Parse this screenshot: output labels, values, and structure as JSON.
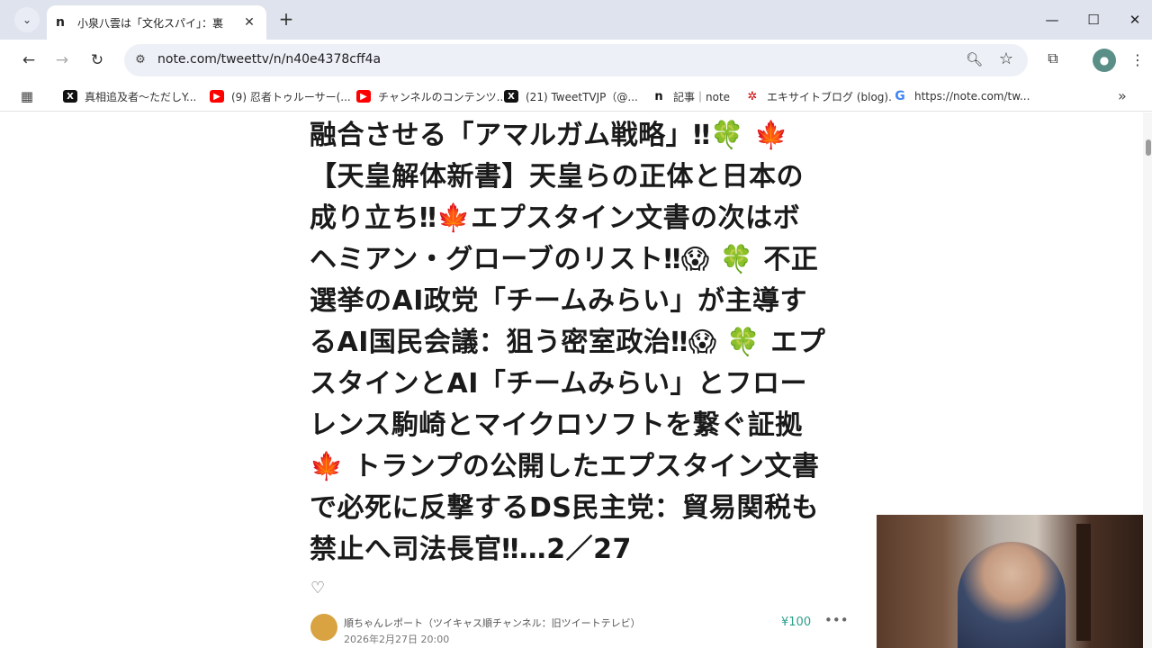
{
  "browser": {
    "tab": {
      "favicon": "n",
      "title": "小泉八雲は「文化スパイ」：裏",
      "close": "✕"
    },
    "new_tab": "+",
    "window_controls": {
      "minimize": "—",
      "maximize": "☐",
      "close": "✕"
    },
    "nav": {
      "back": "←",
      "forward": "→",
      "reload": "↻"
    },
    "url": "note.com/tweettv/n/n40e4378cff4a",
    "menu": "⋮"
  },
  "bookmarks": [
    {
      "icon": "x",
      "label": "真相追及者〜ただしY..."
    },
    {
      "icon": "youtube",
      "label": "(9) 忍者トゥルーサー(..."
    },
    {
      "icon": "youtube",
      "label": "チャンネルのコンテンツ..."
    },
    {
      "icon": "x",
      "label": "(21) TweetTVJP（@..."
    },
    {
      "icon": "note",
      "label": "記事｜note"
    },
    {
      "icon": "excite",
      "label": "エキサイトブログ (blog)..."
    },
    {
      "icon": "google",
      "label": "https://note.com/tw..."
    }
  ],
  "article": {
    "title_lines": [
      "融合させる「アマルガム戦略」‼🍀 🍁",
      "【天皇解体新書】天皇らの正体と日本の",
      "成り立ち‼🍁エプスタイン文書の次はボ",
      "ヘミアン・グローブのリスト‼😱 🍀 不正",
      "選挙のAI政党「チームみらい」が主導す",
      "るAI国民会議：狙う密室政治‼😱 🍀 エプ",
      "スタインとAI「チームみらい」とフロー",
      "レンス駒崎とマイクロソフトを繋ぐ証拠",
      "🍁 トランプの公開したエプスタイン文書",
      "で必死に反撃するDS民主党：貿易関税も",
      "禁止へ司法長官‼…2／27"
    ],
    "author": "順ちゃんレポート（ツイキャス順チャンネル：旧ツイートテレビ）",
    "date": "2026年2月27日 20:00",
    "price": "¥100",
    "like_icon": "heart-icon"
  }
}
